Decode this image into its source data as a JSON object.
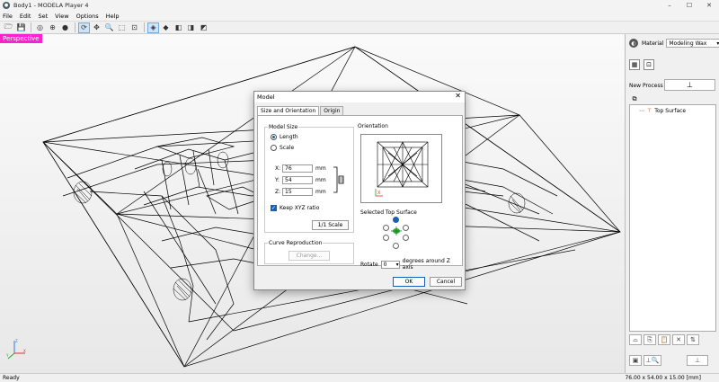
{
  "window": {
    "title": "Body1 - MODELA Player 4"
  },
  "menu": [
    "File",
    "Edit",
    "Set",
    "View",
    "Options",
    "Help"
  ],
  "viewport": {
    "label": "Perspective"
  },
  "panel": {
    "material_label": "Material",
    "material_value": "Modeling Wax",
    "new_process_label": "New Process",
    "tree_item": "Top Surface"
  },
  "status": {
    "left": "Ready",
    "right": "76.00 x 54.00 x 15.00 [mm]"
  },
  "dialog": {
    "title": "Model",
    "tabs": [
      "Size and Orientation",
      "Origin"
    ],
    "model_size_title": "Model Size",
    "radio_length": "Length",
    "radio_scale": "Scale",
    "x_label": "X:",
    "x_value": "76",
    "y_label": "Y:",
    "y_value": "54",
    "z_label": "Z:",
    "z_value": "15",
    "unit": "mm",
    "keep_ratio": "Keep XYZ ratio",
    "scale_button": "1/1 Scale",
    "curve_title": "Curve Reproduction",
    "change_button": "Change...",
    "orientation_title": "Orientation",
    "top_surface_title": "Selected Top Surface",
    "rotate_label": "Rotate",
    "rotate_value": "0",
    "rotate_suffix": "degrees around Z axis",
    "ok": "OK",
    "cancel": "Cancel"
  },
  "colors": {
    "accent": "#1a5fb4",
    "perspective": "#ff22cc"
  }
}
